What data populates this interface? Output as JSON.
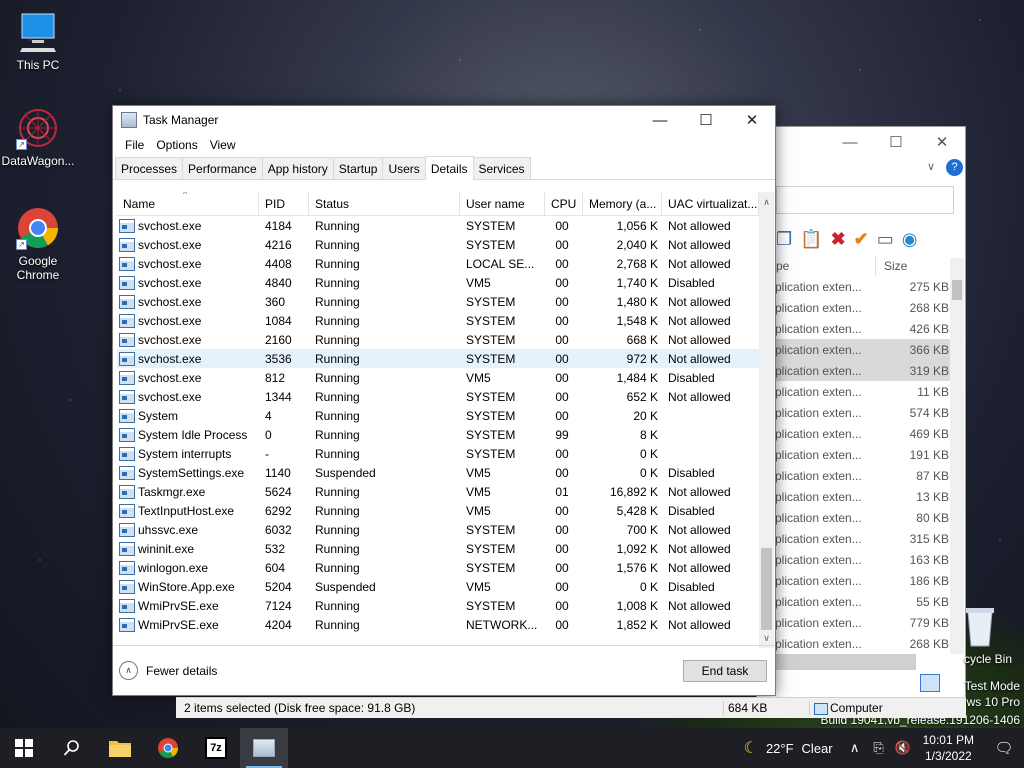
{
  "desktop": {
    "icons": [
      {
        "label": "This PC"
      },
      {
        "label": "DataWagon..."
      },
      {
        "label": "Google Chrome"
      },
      {
        "label": "cycle Bin"
      }
    ],
    "watermark": [
      "Test Mode",
      "ws 10 Pro",
      "Build 19041.vb_release.191206-1406"
    ]
  },
  "task_manager": {
    "title": "Task Manager",
    "controls": {
      "minimize": "—",
      "maximize": "☐",
      "close": "✕"
    },
    "menu": [
      "File",
      "Options",
      "View"
    ],
    "tabs": [
      "Processes",
      "Performance",
      "App history",
      "Startup",
      "Users",
      "Details",
      "Services"
    ],
    "active_tab": "Details",
    "columns": [
      "Name",
      "PID",
      "Status",
      "User name",
      "CPU",
      "Memory (a...",
      "UAC virtualizat..."
    ],
    "rows": [
      [
        "svchost.exe",
        "4184",
        "Running",
        "SYSTEM",
        "00",
        "1,056 K",
        "Not allowed"
      ],
      [
        "svchost.exe",
        "4216",
        "Running",
        "SYSTEM",
        "00",
        "2,040 K",
        "Not allowed"
      ],
      [
        "svchost.exe",
        "4408",
        "Running",
        "LOCAL SE...",
        "00",
        "2,768 K",
        "Not allowed"
      ],
      [
        "svchost.exe",
        "4840",
        "Running",
        "VM5",
        "00",
        "1,740 K",
        "Disabled"
      ],
      [
        "svchost.exe",
        "360",
        "Running",
        "SYSTEM",
        "00",
        "1,480 K",
        "Not allowed"
      ],
      [
        "svchost.exe",
        "1084",
        "Running",
        "SYSTEM",
        "00",
        "1,548 K",
        "Not allowed"
      ],
      [
        "svchost.exe",
        "2160",
        "Running",
        "SYSTEM",
        "00",
        "668 K",
        "Not allowed"
      ],
      [
        "svchost.exe",
        "3536",
        "Running",
        "SYSTEM",
        "00",
        "972 K",
        "Not allowed"
      ],
      [
        "svchost.exe",
        "812",
        "Running",
        "VM5",
        "00",
        "1,484 K",
        "Disabled"
      ],
      [
        "svchost.exe",
        "1344",
        "Running",
        "SYSTEM",
        "00",
        "652 K",
        "Not allowed"
      ],
      [
        "System",
        "4",
        "Running",
        "SYSTEM",
        "00",
        "20 K",
        ""
      ],
      [
        "System Idle Process",
        "0",
        "Running",
        "SYSTEM",
        "99",
        "8 K",
        ""
      ],
      [
        "System interrupts",
        "-",
        "Running",
        "SYSTEM",
        "00",
        "0 K",
        ""
      ],
      [
        "SystemSettings.exe",
        "1140",
        "Suspended",
        "VM5",
        "00",
        "0 K",
        "Disabled"
      ],
      [
        "Taskmgr.exe",
        "5624",
        "Running",
        "VM5",
        "01",
        "16,892 K",
        "Not allowed"
      ],
      [
        "TextInputHost.exe",
        "6292",
        "Running",
        "VM5",
        "00",
        "5,428 K",
        "Disabled"
      ],
      [
        "uhssvc.exe",
        "6032",
        "Running",
        "SYSTEM",
        "00",
        "700 K",
        "Not allowed"
      ],
      [
        "wininit.exe",
        "532",
        "Running",
        "SYSTEM",
        "00",
        "1,092 K",
        "Not allowed"
      ],
      [
        "winlogon.exe",
        "604",
        "Running",
        "SYSTEM",
        "00",
        "1,576 K",
        "Not allowed"
      ],
      [
        "WinStore.App.exe",
        "5204",
        "Suspended",
        "VM5",
        "00",
        "0 K",
        "Disabled"
      ],
      [
        "WmiPrvSE.exe",
        "7124",
        "Running",
        "SYSTEM",
        "00",
        "1,008 K",
        "Not allowed"
      ],
      [
        "WmiPrvSE.exe",
        "4204",
        "Running",
        "NETWORK...",
        "00",
        "1,852 K",
        "Not allowed"
      ]
    ],
    "selected_row_index": 7,
    "fewer_details": "Fewer details",
    "end_task": "End task"
  },
  "explorer": {
    "size_header": "Size",
    "type_header": "pe",
    "rows": [
      {
        "type": "plication exten...",
        "size": "275 KB"
      },
      {
        "type": "plication exten...",
        "size": "268 KB"
      },
      {
        "type": "plication exten...",
        "size": "426 KB"
      },
      {
        "type": "plication exten...",
        "size": "366 KB"
      },
      {
        "type": "plication exten...",
        "size": "319 KB"
      },
      {
        "type": "plication exten...",
        "size": "11 KB"
      },
      {
        "type": "plication exten...",
        "size": "574 KB"
      },
      {
        "type": "plication exten...",
        "size": "469 KB"
      },
      {
        "type": "plication exten...",
        "size": "191 KB"
      },
      {
        "type": "plication exten...",
        "size": "87 KB"
      },
      {
        "type": "plication exten...",
        "size": "13 KB"
      },
      {
        "type": "plication exten...",
        "size": "80 KB"
      },
      {
        "type": "plication exten...",
        "size": "315 KB"
      },
      {
        "type": "plication exten...",
        "size": "163 KB"
      },
      {
        "type": "plication exten...",
        "size": "186 KB"
      },
      {
        "type": "plication exten...",
        "size": "55 KB"
      },
      {
        "type": "plication exten...",
        "size": "779 KB"
      },
      {
        "type": "plication exten...",
        "size": "268 KB"
      }
    ],
    "selected_rows": [
      3,
      4
    ],
    "status": {
      "selection": "2 items selected (Disk free space: 91.8 GB)",
      "size": "684 KB",
      "location": "Computer"
    }
  },
  "taskbar": {
    "weather_temp": "22°F",
    "weather_text": "Clear",
    "time": "10:01 PM",
    "date": "1/3/2022"
  }
}
